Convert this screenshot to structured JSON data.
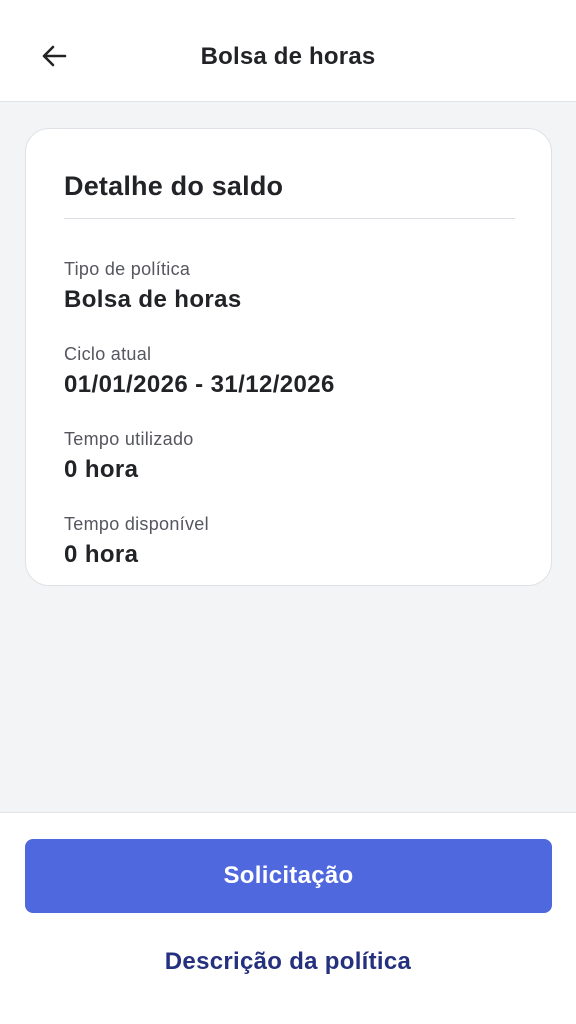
{
  "header": {
    "title": "Bolsa de horas",
    "back_icon": "arrow-left-icon"
  },
  "card": {
    "title": "Detalhe do saldo",
    "fields": [
      {
        "label": "Tipo de política",
        "value": "Bolsa de horas"
      },
      {
        "label": "Ciclo atual",
        "value": "01/01/2026 - 31/12/2026"
      },
      {
        "label": "Tempo utilizado",
        "value": "0 hora"
      },
      {
        "label": "Tempo disponível",
        "value": "0 hora"
      }
    ]
  },
  "footer": {
    "primary_label": "Solicitação",
    "link_label": "Descrição da política"
  },
  "colors": {
    "primary": "#5068de",
    "link": "#25307e",
    "background": "#f3f4f6"
  }
}
